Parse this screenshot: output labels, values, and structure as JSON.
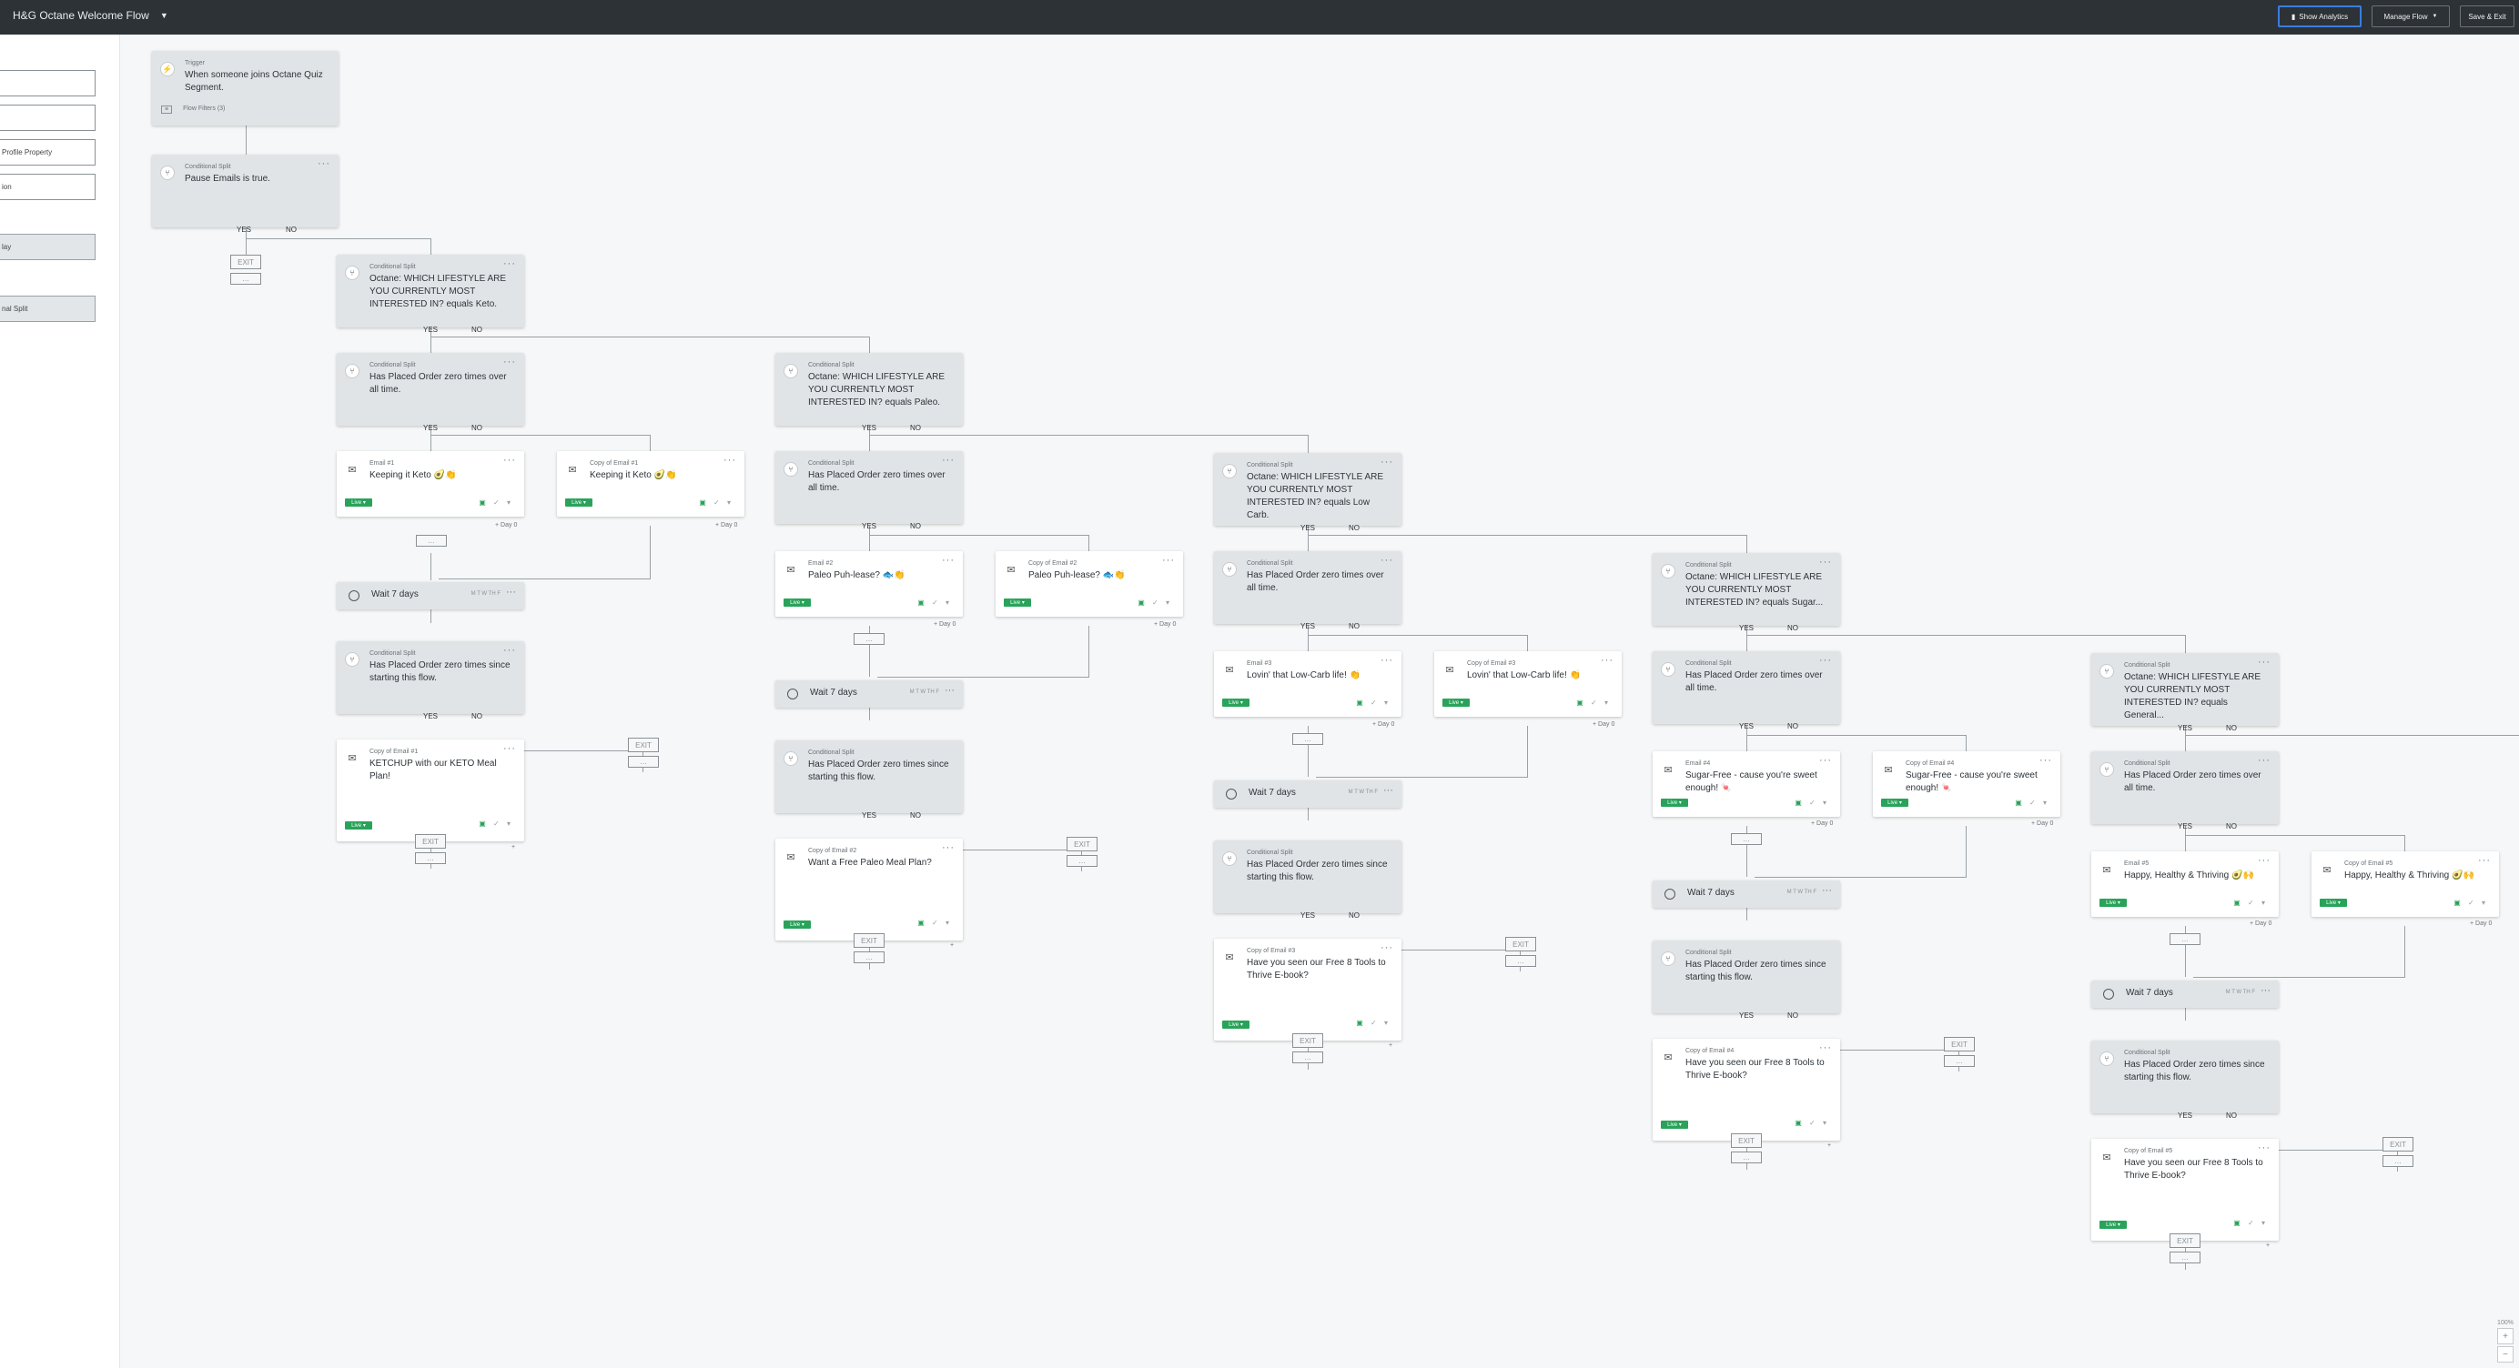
{
  "topbar": {
    "flow_title": "H&G Octane Welcome Flow",
    "show_analytics": "Show Analytics",
    "manage_flow": "Manage Flow",
    "save_exit": "Save & Exit"
  },
  "left_panel": {
    "items": [
      "",
      "",
      "Profile Property",
      "ion",
      "lay",
      "nal Split"
    ]
  },
  "labels": {
    "trigger": "Trigger",
    "conditional_split": "Conditional Split",
    "yes": "YES",
    "no": "NO",
    "exit": "EXIT",
    "live": "Live",
    "day0": "Day 0",
    "wait": "Wait 7 days",
    "wait_days": "M T W TH F",
    "plus": "+"
  },
  "trigger": {
    "text": "When someone joins Octane Quiz Segment.",
    "filters": "Flow Filters (3)"
  },
  "splits": {
    "pause": "Pause Emails is true.",
    "keto": "Octane: WHICH LIFESTYLE ARE YOU CURRENTLY MOST INTERESTED IN? equals Keto.",
    "paleo": "Octane: WHICH LIFESTYLE ARE YOU CURRENTLY MOST INTERESTED IN? equals Paleo.",
    "lowcarb": "Octane: WHICH LIFESTYLE ARE YOU CURRENTLY MOST INTERESTED IN? equals Low Carb.",
    "sugar": "Octane: WHICH LIFESTYLE ARE YOU CURRENTLY MOST INTERESTED IN? equals Sugar...",
    "general": "Octane: WHICH LIFESTYLE ARE YOU CURRENTLY MOST INTERESTED IN? equals General...",
    "placed_over_all_time": "Has Placed Order zero times over all time.",
    "placed_since_flow": "Has Placed Order zero times since starting this flow."
  },
  "emails": {
    "e1": {
      "label": "Email #1",
      "title": "Keeping it Keto 🥑👏"
    },
    "c1": {
      "label": "Copy of Email #1",
      "title": "Keeping it Keto 🥑👏"
    },
    "c1b": {
      "label": "Copy of Email #1",
      "title": "KETCHUP with our KETO Meal Plan!"
    },
    "e2": {
      "label": "Email #2",
      "title": "Paleo Puh-lease? 🐟👏"
    },
    "c2": {
      "label": "Copy of Email #2",
      "title": "Paleo Puh-lease? 🐟👏"
    },
    "c2b": {
      "label": "Copy of Email #2",
      "title": "Want a Free Paleo Meal Plan?"
    },
    "e3": {
      "label": "Email #3",
      "title": "Lovin' that Low-Carb life! 👏"
    },
    "c3": {
      "label": "Copy of Email #3",
      "title": "Lovin' that Low-Carb life! 👏"
    },
    "c3b": {
      "label": "Copy of Email #3",
      "title": "Have you seen our Free 8 Tools to Thrive E-book?"
    },
    "e4": {
      "label": "Email #4",
      "title": "Sugar-Free - cause you're sweet enough! 🍬"
    },
    "c4": {
      "label": "Copy of Email #4",
      "title": "Sugar-Free - cause you're sweet enough! 🍬"
    },
    "c4b": {
      "label": "Copy of Email #4",
      "title": "Have you seen our Free 8 Tools to Thrive E-book?"
    },
    "e5": {
      "label": "Email #5",
      "title": "Happy, Healthy & Thriving 🥑🙌"
    },
    "c5": {
      "label": "Copy of Email #5",
      "title": "Happy, Healthy & Thriving 🥑🙌"
    },
    "c5b": {
      "label": "Copy of Email #5",
      "title": "Have you seen our Free 8 Tools to Thrive E-book?"
    }
  },
  "zoom": {
    "level": "100%",
    "plus": "+",
    "minus": "−"
  }
}
